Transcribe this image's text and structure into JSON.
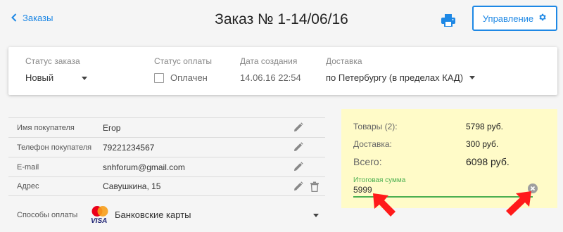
{
  "header": {
    "back_label": "Заказы",
    "title": "Заказ № 1-14/06/16",
    "manage_label": "Управление"
  },
  "status": {
    "order_status_label": "Статус заказа",
    "order_status_value": "Новый",
    "payment_status_label": "Статус оплаты",
    "payment_checkbox_label": "Оплачен",
    "created_label": "Дата создания",
    "created_value": "14.06.16 22:54",
    "delivery_label": "Доставка",
    "delivery_value": "по Петербургу (в пределах КАД)"
  },
  "customer": {
    "rows": [
      {
        "label": "Имя покупателя",
        "value": "Егор"
      },
      {
        "label": "Телефон покупателя",
        "value": "79221234567"
      },
      {
        "label": "E-mail",
        "value": "snhforum@gmail.com"
      },
      {
        "label": "Адрес",
        "value": "Савушкина, 15"
      }
    ],
    "payment_label": "Способы оплаты",
    "payment_value": "Банковские карты",
    "visa_text": "VISA"
  },
  "summary": {
    "goods_label": "Товары (2):",
    "goods_value": "5798 руб.",
    "delivery_label": "Доставка:",
    "delivery_value": "300 руб.",
    "total_label": "Всего:",
    "total_value": "6098 руб.",
    "total_field_label": "Итоговая сумма",
    "total_field_value": "5999"
  },
  "colors": {
    "accent": "#1e88e5",
    "summary_bg": "#fffbc8",
    "field_active": "#4caf50",
    "annotation_arrow": "#ff1a1a"
  }
}
